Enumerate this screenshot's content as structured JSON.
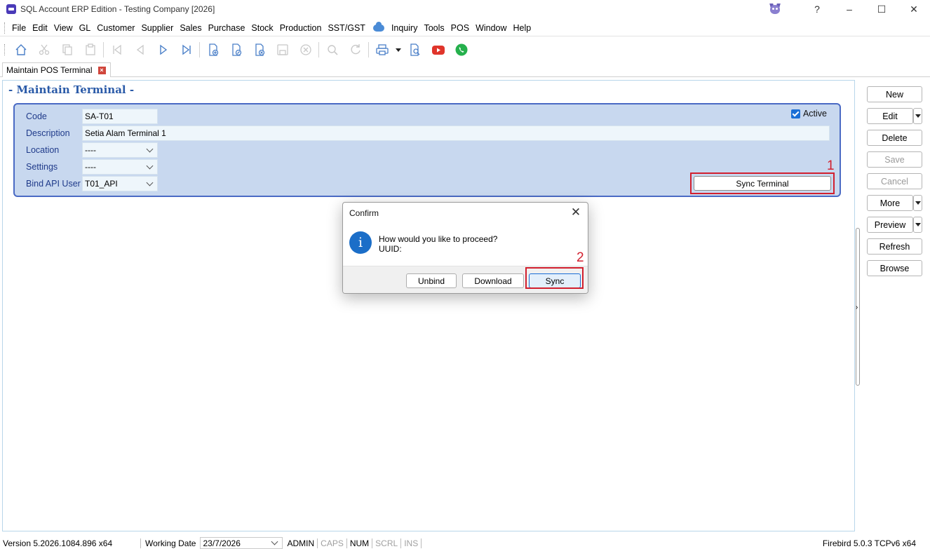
{
  "window": {
    "title": "SQL Account ERP Edition - Testing Company [2026]",
    "help_label": "?",
    "minimize": "–",
    "maximize": "☐",
    "close": "✕"
  },
  "menu": [
    {
      "label": "File"
    },
    {
      "label": "Edit"
    },
    {
      "label": "View"
    },
    {
      "label": "GL"
    },
    {
      "label": "Customer"
    },
    {
      "label": "Supplier"
    },
    {
      "label": "Sales"
    },
    {
      "label": "Purchase"
    },
    {
      "label": "Stock"
    },
    {
      "label": "Production"
    },
    {
      "label": "SST/GST"
    },
    {
      "label": "Inquiry"
    },
    {
      "label": "Tools"
    },
    {
      "label": "POS"
    },
    {
      "label": "Window"
    },
    {
      "label": "Help"
    }
  ],
  "tab": {
    "label": "Maintain POS Terminal",
    "close": "×"
  },
  "form": {
    "title": "- Maintain Terminal -",
    "code_label": "Code",
    "code_value": "SA-T01",
    "description_label": "Description",
    "description_value": "Setia Alam Terminal 1",
    "location_label": "Location",
    "location_value": "----",
    "settings_label": "Settings",
    "settings_value": "----",
    "bind_label": "Bind API User",
    "bind_value": "T01_API",
    "active_label": "Active",
    "sync_terminal_label": "Sync Terminal",
    "marker_1": "1"
  },
  "side_buttons": {
    "new": "New",
    "edit": "Edit",
    "delete": "Delete",
    "save": "Save",
    "cancel": "Cancel",
    "more": "More",
    "preview": "Preview",
    "refresh": "Refresh",
    "browse": "Browse"
  },
  "dialog": {
    "title": "Confirm",
    "close": "✕",
    "icon": "i",
    "message": "How would you like to proceed?",
    "uuid_label": "UUID:",
    "unbind": "Unbind",
    "download": "Download",
    "sync": "Sync",
    "marker_2": "2"
  },
  "status": {
    "version": "Version 5.2026.1084.896 x64",
    "working_date_label": "Working Date",
    "working_date_value": "23/7/2026",
    "user": "ADMIN",
    "caps": "CAPS",
    "num": "NUM",
    "scrl": "SCRL",
    "ins": "INS",
    "db": "Firebird 5.0.3 TCPv6 x64"
  },
  "colors": {
    "accent_blue": "#1a6ed6",
    "panel_bg": "#c8d8ef",
    "panel_border": "#4a6ac4",
    "highlight_red": "#d21f2e",
    "title_blue": "#2a5aa8"
  }
}
